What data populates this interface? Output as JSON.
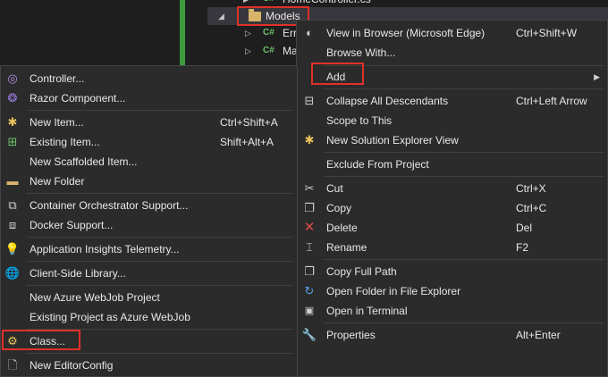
{
  "tree": {
    "top_item": "HomeController.cs",
    "folder": "Models",
    "child1": "Err",
    "child2": "Ma",
    "cs_badge": "C#"
  },
  "context_menu": {
    "items": [
      {
        "label": "View in Browser (Microsoft Edge)",
        "shortcut": "Ctrl+Shift+W",
        "icon": "browser-icon"
      },
      {
        "label": "Browse With...",
        "shortcut": ""
      },
      {
        "label": "Add",
        "shortcut": "",
        "submenu": true
      },
      {
        "label": "Collapse All Descendants",
        "shortcut": "Ctrl+Left Arrow",
        "icon": "collapse-icon"
      },
      {
        "label": "Scope to This",
        "shortcut": ""
      },
      {
        "label": "New Solution Explorer View",
        "shortcut": "",
        "icon": "new-view-icon"
      },
      {
        "label": "Exclude From Project",
        "shortcut": ""
      },
      {
        "label": "Cut",
        "shortcut": "Ctrl+X",
        "icon": "scissors-icon"
      },
      {
        "label": "Copy",
        "shortcut": "Ctrl+C",
        "icon": "copy-icon"
      },
      {
        "label": "Delete",
        "shortcut": "Del",
        "icon": "delete-icon"
      },
      {
        "label": "Rename",
        "shortcut": "F2",
        "icon": "rename-icon"
      },
      {
        "label": "Copy Full Path",
        "shortcut": "",
        "icon": "copy-path-icon"
      },
      {
        "label": "Open Folder in File Explorer",
        "shortcut": "",
        "icon": "open-folder-icon"
      },
      {
        "label": "Open in Terminal",
        "shortcut": "",
        "icon": "terminal-icon"
      },
      {
        "label": "Properties",
        "shortcut": "Alt+Enter",
        "icon": "wrench-icon"
      }
    ]
  },
  "add_submenu": {
    "items": [
      {
        "label": "Controller...",
        "shortcut": ""
      },
      {
        "label": "Razor Component...",
        "shortcut": ""
      },
      {
        "label": "New Item...",
        "shortcut": "Ctrl+Shift+A"
      },
      {
        "label": "Existing Item...",
        "shortcut": "Shift+Alt+A"
      },
      {
        "label": "New Scaffolded Item...",
        "shortcut": ""
      },
      {
        "label": "New Folder",
        "shortcut": ""
      },
      {
        "label": "Container Orchestrator Support...",
        "shortcut": ""
      },
      {
        "label": "Docker Support...",
        "shortcut": ""
      },
      {
        "label": "Application Insights Telemetry...",
        "shortcut": ""
      },
      {
        "label": "Client-Side Library...",
        "shortcut": ""
      },
      {
        "label": "New Azure WebJob Project",
        "shortcut": ""
      },
      {
        "label": "Existing Project as Azure WebJob",
        "shortcut": ""
      },
      {
        "label": "Class...",
        "shortcut": ""
      },
      {
        "label": "New EditorConfig",
        "shortcut": ""
      }
    ]
  },
  "colors": {
    "highlight_border": "#e0302a",
    "menu_bg": "#2b2b2b",
    "tree_bg": "#1e1e1e",
    "project_bar": "#3e9b3e"
  }
}
